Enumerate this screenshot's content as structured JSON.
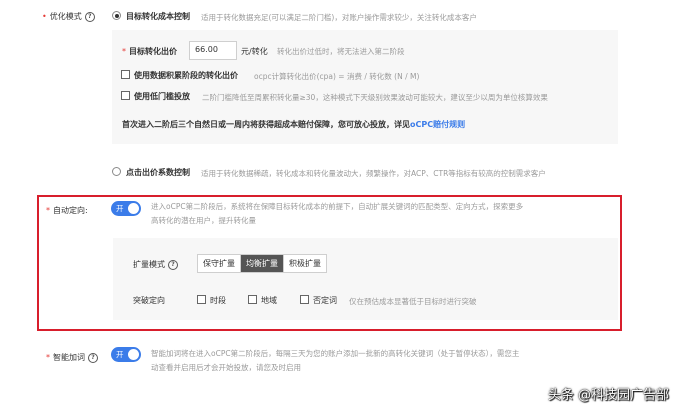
{
  "optimization_mode": {
    "label": "优化模式",
    "target_conversion": {
      "title": "目标转化成本控制",
      "desc": "适用于转化数据充足(可以满足二阶门槛)，对账户操作需求较少，关注转化成本客户"
    },
    "target_bid": {
      "label": "目标转化出价",
      "value": "66.00",
      "unit": "元/转化",
      "hint": "转化出价过低时，将无法进入第二阶段"
    },
    "use_accumulated_bid": {
      "label": "使用数据积累阶段的转化出价",
      "hint": "ocpc计算转化出价(cpa) = 消费 / 转化数 (N / M)"
    },
    "low_threshold": {
      "label": "使用低门槛投放",
      "hint": "二阶门槛降低至周累积转化量≥30，这种模式下天级别效果波动可能较大，建议至少以周为单位核算效果"
    },
    "guarantee_note": "首次进入二阶后三个自然日或一周内将获得超成本赔付保障，您可放心投放，详见",
    "guarantee_link": "oCPC赔付规则",
    "click_bid": {
      "title": "点击出价系数控制",
      "desc": "适用于转化数据稀疏，转化成本和转化量波动大，频繁操作，对ACP、CTR等指标有较高的控制需求客户"
    }
  },
  "auto_targeting": {
    "label": "自动定向",
    "toggle": "开",
    "desc_line1": "进入oCPC第二阶段后，系统将在保障目标转化成本的前提下，自动扩展关键词的匹配类型、定向方式，探索更多",
    "desc_line2": "高转化的潜在用户，提升转化量",
    "expand_mode": {
      "label": "扩量模式",
      "options": [
        "保守扩量",
        "均衡扩量",
        "积极扩量"
      ],
      "selected": "均衡扩量"
    },
    "breakthrough": {
      "label": "突破定向",
      "options": [
        "时段",
        "地域",
        "否定词"
      ],
      "hint": "仅在预估成本显著低于目标时进行突破"
    }
  },
  "smart_keywords": {
    "label": "智能加词",
    "toggle": "开",
    "desc_line1": "智能加词将在进入oCPC第二阶段后，每隔三天为您的账户添加一批新的高转化关键词（处于暂停状态），需您主",
    "desc_line2": "动查看并启用后才会开始投放，请您及时启用"
  },
  "watermark": "头条 @科技园广告部",
  "colors": {
    "accent": "#3b7ce9",
    "highlight_border": "#d81e2c",
    "required": "#e53935"
  }
}
